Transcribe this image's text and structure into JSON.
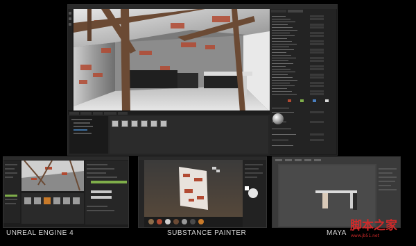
{
  "main_window": {
    "title": "",
    "content_browser": {
      "tabs": [
        "",
        "",
        "",
        "",
        ""
      ],
      "asset_count": 6
    }
  },
  "captions": {
    "unreal": "UNREAL ENGINE 4",
    "substance": "SUBSTANCE PAINTER",
    "maya": "MAYA"
  },
  "watermark": {
    "title": "脚本之家",
    "url": "www.jb51.net"
  },
  "colors": {
    "background": "#000000",
    "panel": "#232323",
    "brick": "#b24a32",
    "watermark": "#d02a2a"
  }
}
